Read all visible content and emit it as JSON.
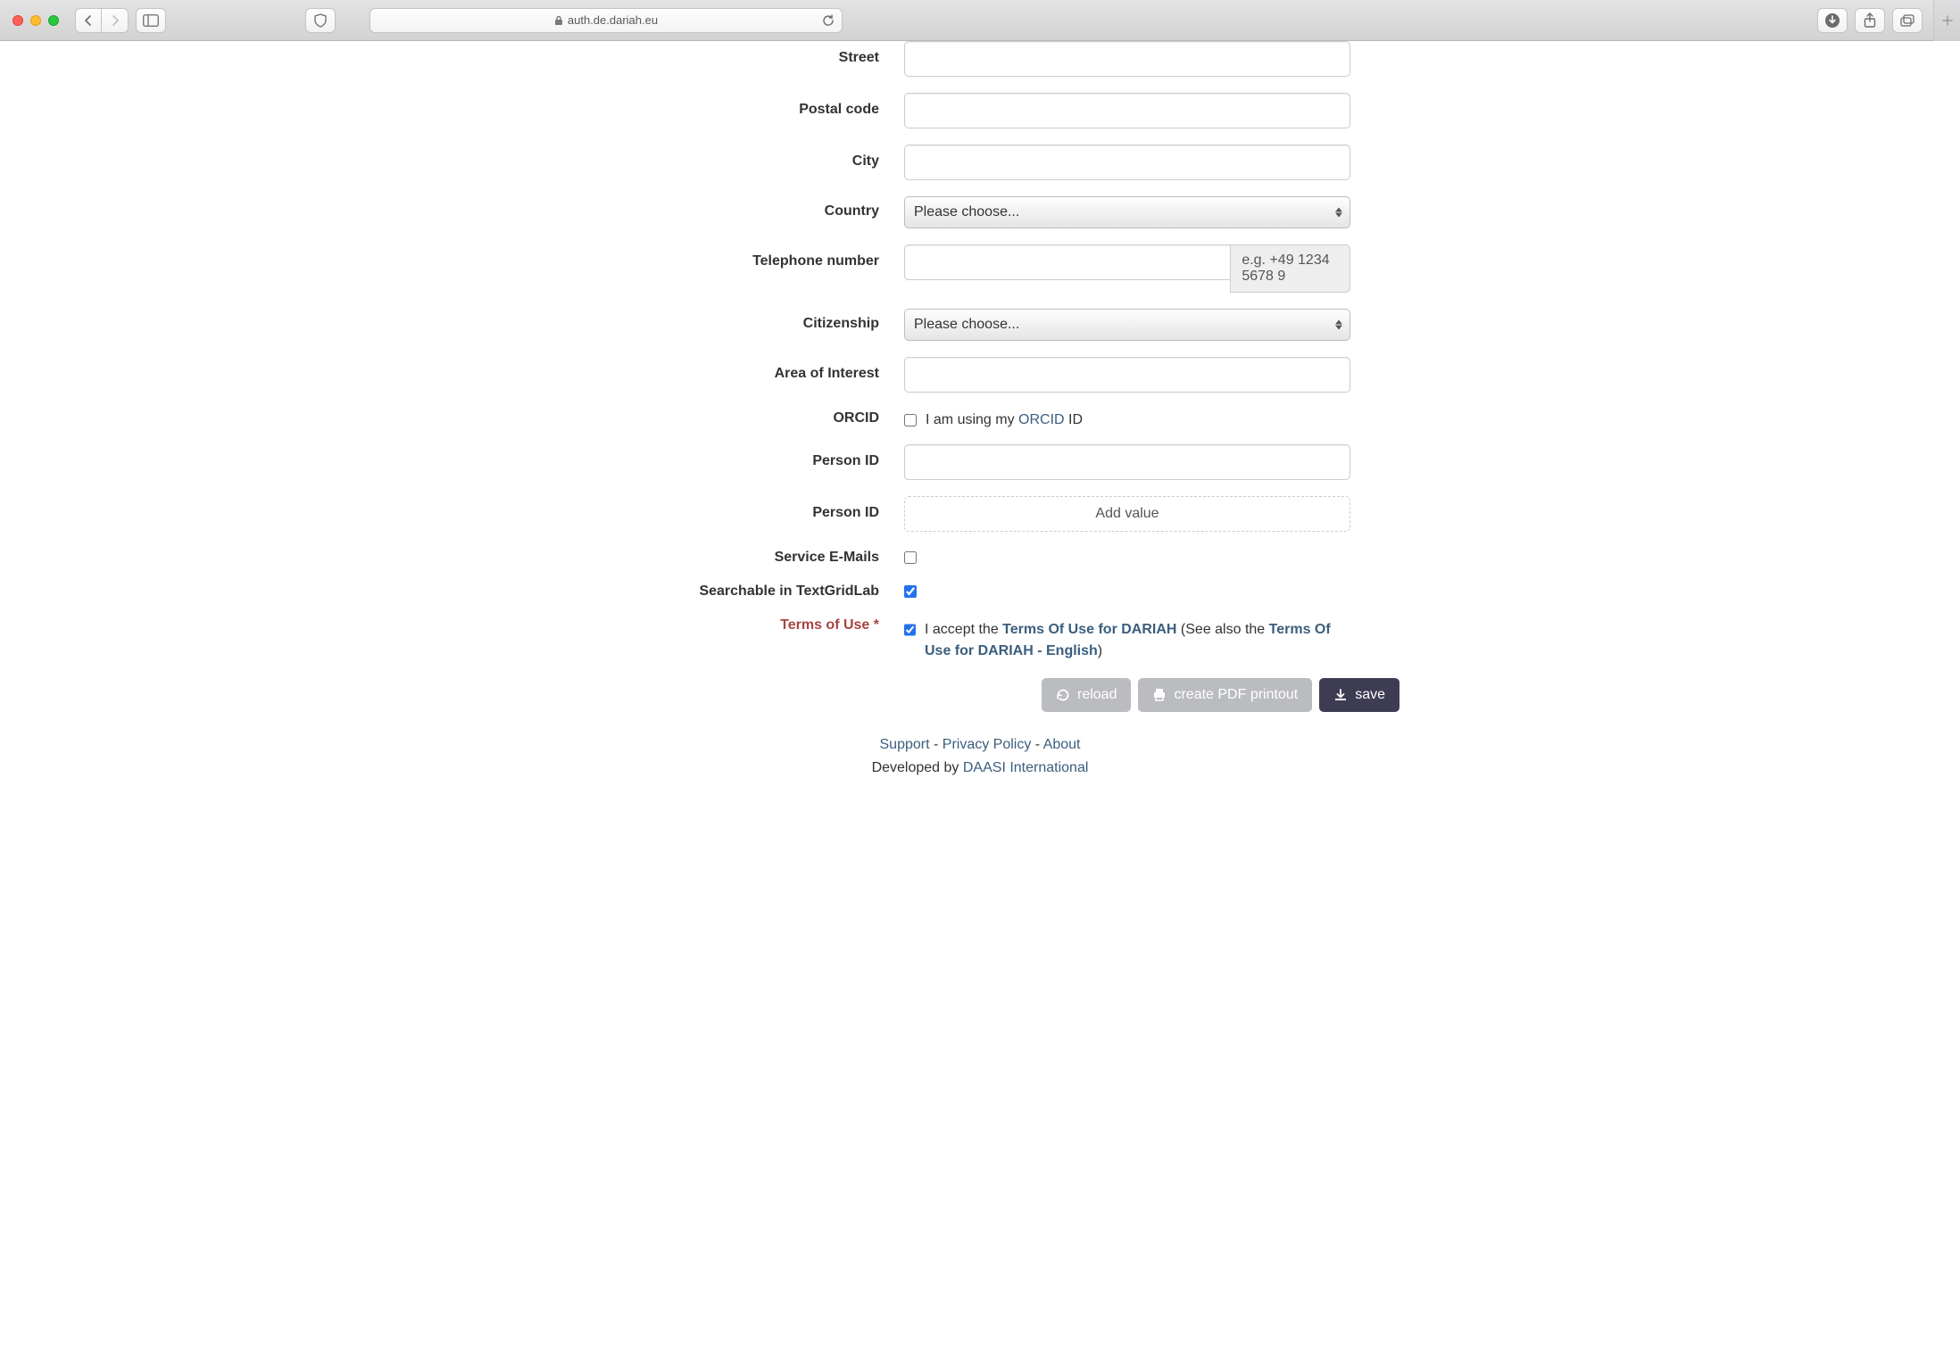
{
  "browser": {
    "url": "auth.de.dariah.eu"
  },
  "form": {
    "street": {
      "label": "Street",
      "value": ""
    },
    "postal_code": {
      "label": "Postal code",
      "value": ""
    },
    "city": {
      "label": "City",
      "value": ""
    },
    "country": {
      "label": "Country",
      "placeholder": "Please choose..."
    },
    "telephone": {
      "label": "Telephone number",
      "value": "",
      "hint": "e.g. +49 1234 5678 9"
    },
    "citizenship": {
      "label": "Citizenship",
      "placeholder": "Please choose..."
    },
    "area_of_interest": {
      "label": "Area of Interest",
      "value": ""
    },
    "orcid": {
      "label": "ORCID",
      "checkbox_prefix": "I am using my ",
      "link": "ORCID",
      "suffix": " ID",
      "checked": false
    },
    "person_id": {
      "label": "Person ID",
      "value": ""
    },
    "person_id2": {
      "label": "Person ID",
      "add_value": "Add value"
    },
    "service_emails": {
      "label": "Service E-Mails",
      "checked": false
    },
    "searchable": {
      "label": "Searchable in TextGridLab",
      "checked": true
    },
    "terms": {
      "label": "Terms of Use *",
      "checked": true,
      "prefix": "I accept the ",
      "link1": "Terms Of Use for DARIAH",
      "mid": " (See also the ",
      "link2": "Terms Of Use for DARIAH - English",
      "suffix": ")"
    }
  },
  "buttons": {
    "reload": "reload",
    "pdf": "create PDF printout",
    "save": "save"
  },
  "footer": {
    "support": "Support",
    "privacy": "Privacy Policy",
    "about": "About",
    "sep": " - ",
    "dev_prefix": "Developed by ",
    "dev_link": "DAASI International"
  }
}
